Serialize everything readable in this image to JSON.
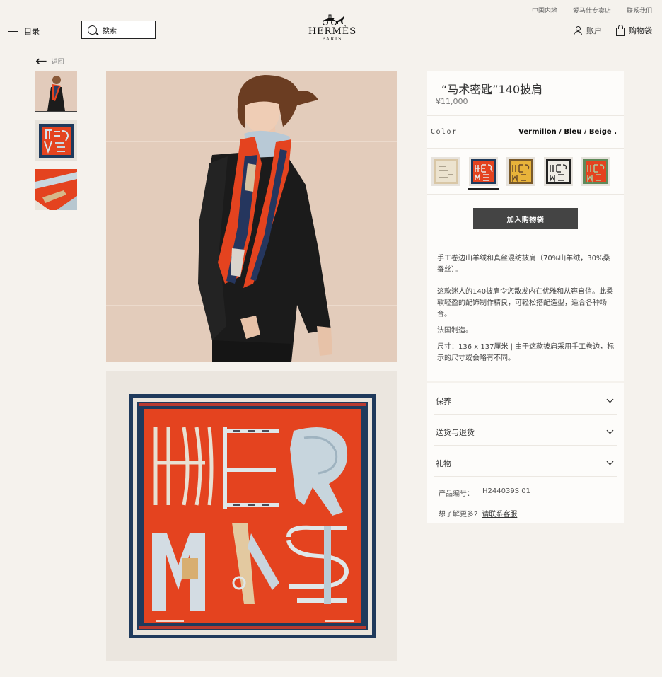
{
  "utility_links": [
    "中国内地",
    "爱马仕专卖店",
    "联系我们"
  ],
  "header": {
    "menu_label": "目录",
    "search_placeholder": "搜索",
    "logo_brand": "HERMÈS",
    "logo_city": "PARIS",
    "account_label": "账户",
    "bag_label": "购物袋"
  },
  "back_label": "返回",
  "product": {
    "title": "“马术密匙”140披肩",
    "price": "¥11,000",
    "color_label": "Color",
    "color_value": "Vermillon / Bleu / Beige .",
    "swatches": [
      {
        "name": "beige-swatch",
        "color": "#d9c7a6"
      },
      {
        "name": "vermillon-swatch",
        "color": "#e4431f"
      },
      {
        "name": "yellow-swatch",
        "color": "#e8b33a"
      },
      {
        "name": "black-white-swatch",
        "color": "#3a3a3a"
      },
      {
        "name": "green-swatch",
        "color": "#5f8a5a"
      }
    ],
    "add_to_bag": "加入购物袋",
    "description": [
      "手工卷边山羊绒和真丝混纺披肩（70%山羊绒，30%桑蚕丝）。",
      "这款迷人的140披肩令您散发内在优雅和从容自信。此柔软轻盈的配饰制作精良，可轻松搭配造型，适合各种场合。",
      "法国制造。",
      "尺寸：136 x 137厘米 | 由于这款披肩采用手工卷边，标示的尺寸或会略有不同。"
    ]
  },
  "accordion": [
    "保养",
    "送货与退货",
    "礼物"
  ],
  "reference_label": "产品编号：",
  "reference_value": "H244039S 01",
  "help_text": "想了解更多?",
  "help_link": "请联系客服",
  "colors": {
    "background": "#f5f2ed",
    "panel": "#fdfcfa",
    "button": "#444444",
    "scarf_orange": "#e4431f",
    "scarf_navy": "#1f3a5c"
  }
}
